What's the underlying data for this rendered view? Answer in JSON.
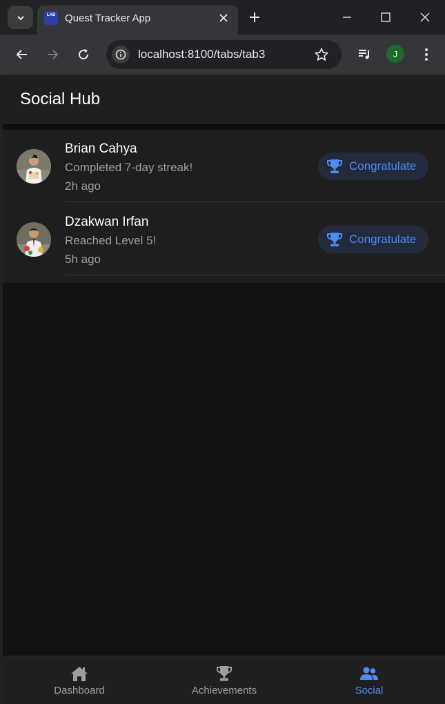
{
  "browser": {
    "tab_title": "Quest Tracker App",
    "favicon_text": "LAB",
    "url": "localhost:8100/tabs/tab3",
    "profile_initial": "J"
  },
  "app": {
    "header_title": "Social Hub",
    "feed": [
      {
        "name": "Brian Cahya",
        "activity": "Completed 7-day streak!",
        "time": "2h ago",
        "button_label": "Congratulate",
        "button_icon": "trophy-icon"
      },
      {
        "name": "Dzakwan Irfan",
        "activity": "Reached Level 5!",
        "time": "5h ago",
        "button_label": "Congratulate",
        "button_icon": "trophy-icon"
      }
    ],
    "tabs": [
      {
        "label": "Dashboard",
        "icon": "home-icon",
        "active": false
      },
      {
        "label": "Achievements",
        "icon": "trophy-icon",
        "active": false
      },
      {
        "label": "Social",
        "icon": "people-icon",
        "active": true
      }
    ]
  },
  "colors": {
    "accent": "#4d8bf5",
    "header_bg": "#1f1f1f",
    "content_bg": "#121212",
    "feed_bg": "#1e1e1e",
    "button_bg": "#222a3b"
  }
}
